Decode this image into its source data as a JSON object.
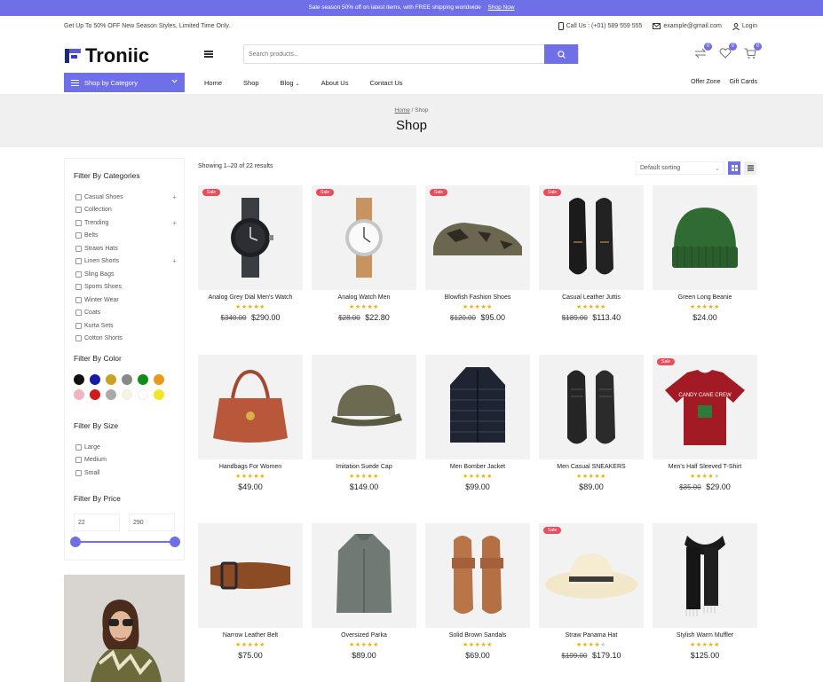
{
  "promo": {
    "text": "Sale season 50% off on latest items, with FREE shipping worldwide",
    "link": "Shop Now"
  },
  "topbar": {
    "left": "Get Up To 50% OFF New Season Styles, Limited Time Only.",
    "call": "Call Us : (+01) 589 559 555",
    "email": "example@gmail.com",
    "login": "Login"
  },
  "header": {
    "logo": "Troniic",
    "search_placeholder": "Search products...",
    "compare_count": "0",
    "wishlist_count": "0",
    "cart_count": "0"
  },
  "nav": {
    "category_button": "Shop by Category",
    "items": [
      "Home",
      "Shop",
      "Blog",
      "About Us",
      "Contact Us"
    ],
    "right": [
      "Offer Zone",
      "Gift Cards"
    ]
  },
  "hero": {
    "crumb_home": "Home",
    "crumb_sep": " / ",
    "crumb_current": "Shop",
    "title": "Shop"
  },
  "sidebar": {
    "categories_title": "Filter By Categories",
    "categories": [
      {
        "label": "Casual Shoes",
        "plus": "+"
      },
      {
        "label": "Collection",
        "plus": ""
      },
      {
        "label": "Trending",
        "plus": "+"
      },
      {
        "label": "Belts",
        "plus": ""
      },
      {
        "label": "Straws Hats",
        "plus": ""
      },
      {
        "label": "Linen Shorts",
        "plus": "+"
      },
      {
        "label": "Sling Bags",
        "plus": ""
      },
      {
        "label": "Sports Shoes",
        "plus": ""
      },
      {
        "label": "Winter Wear",
        "plus": ""
      },
      {
        "label": "Coats",
        "plus": ""
      },
      {
        "label": "Kurta Sets",
        "plus": ""
      },
      {
        "label": "Cotton Shorts",
        "plus": ""
      }
    ],
    "color_title": "Filter By Color",
    "colors": [
      "#111111",
      "#1a1aa8",
      "#c9a227",
      "#888888",
      "#138a1a",
      "#e89a1c",
      "#f2b3c0",
      "#d21a1a",
      "#aaaaaa",
      "#f5f5e0",
      "#ffffff",
      "#f2e62a"
    ],
    "size_title": "Filter By Size",
    "sizes": [
      "Large",
      "Medium",
      "Small"
    ],
    "price_title": "Filter By Price",
    "price_min": "22",
    "price_max": "290"
  },
  "toolbar": {
    "results": "Showing 1–20 of 22 results",
    "sort": "Default sorting"
  },
  "products": [
    {
      "name": "Analog Grey Dial Men's Watch",
      "old": "$340.00",
      "price": "$290.00",
      "sale": "Sale",
      "stars": 5,
      "img": "watch-dark"
    },
    {
      "name": "Analog Watch Men",
      "old": "$28.00",
      "price": "$22.80",
      "sale": "Sale",
      "stars": 5,
      "img": "watch-light"
    },
    {
      "name": "Blowfish Fashion Shoes",
      "old": "$120.00",
      "price": "$95.00",
      "sale": "Sale",
      "stars": 5,
      "img": "sneaker-camo"
    },
    {
      "name": "Casual Leather Juttis",
      "old": "$189.00",
      "price": "$113.40",
      "sale": "Sale",
      "stars": 5,
      "img": "leather-shoes"
    },
    {
      "name": "Green Long Beanie",
      "old": "",
      "price": "$24.00",
      "sale": "",
      "stars": 5,
      "img": "beanie"
    },
    {
      "name": "Handbags For Women",
      "old": "",
      "price": "$49.00",
      "sale": "",
      "stars": 5,
      "img": "handbag"
    },
    {
      "name": "Imitation Suede Cap",
      "old": "",
      "price": "$149.00",
      "sale": "",
      "stars": 5,
      "img": "cap"
    },
    {
      "name": "Men Bomber Jacket",
      "old": "",
      "price": "$99.00",
      "sale": "",
      "stars": 5,
      "img": "jacket"
    },
    {
      "name": "Men Casual SNEAKERS",
      "old": "",
      "price": "$89.00",
      "sale": "",
      "stars": 5,
      "img": "sneakers-black"
    },
    {
      "name": "Men's Half Sleeved T-Shirt",
      "old": "$35.00",
      "price": "$29.00",
      "sale": "Sale",
      "stars": 4,
      "img": "tshirt",
      "tshirt_text": "CANDY CANE CREW"
    },
    {
      "name": "Narrow Leather Belt",
      "old": "",
      "price": "$75.00",
      "sale": "",
      "stars": 5,
      "img": "belt"
    },
    {
      "name": "Oversized Parka",
      "old": "",
      "price": "$89.00",
      "sale": "",
      "stars": 5,
      "img": "parka"
    },
    {
      "name": "Solid Brown Sandals",
      "old": "",
      "price": "$69.00",
      "sale": "",
      "stars": 5,
      "img": "sandals"
    },
    {
      "name": "Straw Panama Hat",
      "old": "$199.00",
      "price": "$179.10",
      "sale": "Sale",
      "stars": 4,
      "img": "hat"
    },
    {
      "name": "Stylish Warm Muffler",
      "old": "",
      "price": "$125.00",
      "sale": "",
      "stars": 5,
      "img": "muffler"
    }
  ],
  "accent": "#6f6fe8",
  "sale_color": "#e84f5e",
  "star_color": "#f0b400"
}
